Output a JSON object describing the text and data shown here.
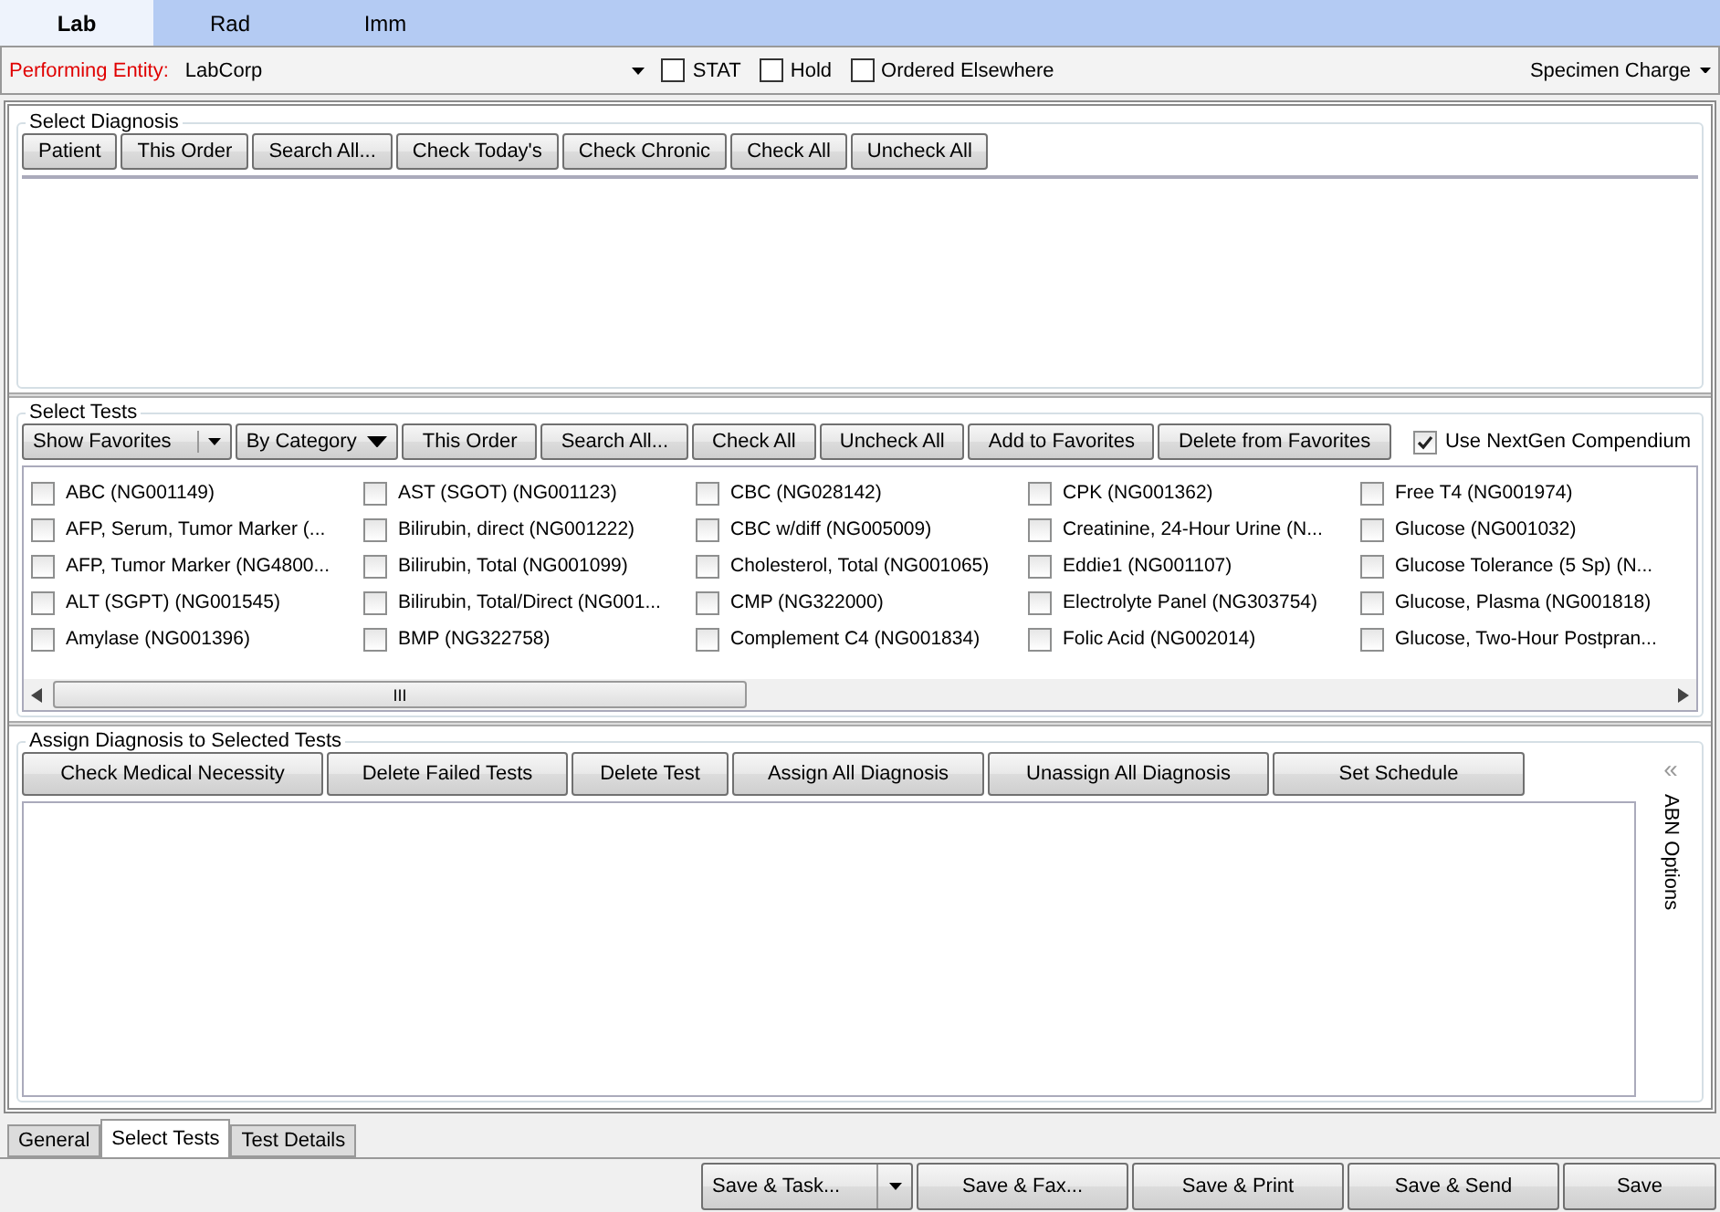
{
  "top_tabs": [
    {
      "label": "Lab",
      "selected": true
    },
    {
      "label": "Rad",
      "selected": false
    },
    {
      "label": "Imm",
      "selected": false
    }
  ],
  "entity_bar": {
    "label": "Performing Entity:",
    "value": "LabCorp",
    "options": [
      {
        "label": "STAT",
        "checked": false
      },
      {
        "label": "Hold",
        "checked": false
      },
      {
        "label": "Ordered Elsewhere",
        "checked": false
      }
    ],
    "menu": "Specimen Charge"
  },
  "diagnosis": {
    "title": "Select Diagnosis",
    "buttons": [
      "Patient",
      "This Order",
      "Search All...",
      "Check Today's",
      "Check Chronic",
      "Check All",
      "Uncheck All"
    ]
  },
  "tests": {
    "title": "Select Tests",
    "favorites": "Show Favorites",
    "category": "By Category",
    "buttons": [
      "This Order",
      "Search All...",
      "Check All",
      "Uncheck All",
      "Add to Favorites",
      "Delete from Favorites"
    ],
    "compendium": {
      "label": "Use NextGen Compendium",
      "checked": true
    },
    "columns": [
      [
        {
          "label": "ABC (NG001149)",
          "checked": false
        },
        {
          "label": "AFP, Serum, Tumor Marker (...",
          "checked": false
        },
        {
          "label": "AFP, Tumor Marker (NG4800...",
          "checked": false
        },
        {
          "label": "ALT (SGPT) (NG001545)",
          "checked": false
        },
        {
          "label": "Amylase (NG001396)",
          "checked": false
        }
      ],
      [
        {
          "label": "AST (SGOT) (NG001123)",
          "checked": false
        },
        {
          "label": "Bilirubin, direct (NG001222)",
          "checked": false
        },
        {
          "label": "Bilirubin, Total (NG001099)",
          "checked": false
        },
        {
          "label": "Bilirubin, Total/Direct (NG001...",
          "checked": false
        },
        {
          "label": "BMP (NG322758)",
          "checked": false
        }
      ],
      [
        {
          "label": "CBC (NG028142)",
          "checked": false
        },
        {
          "label": "CBC w/diff (NG005009)",
          "checked": false
        },
        {
          "label": "Cholesterol, Total (NG001065)",
          "checked": false
        },
        {
          "label": "CMP (NG322000)",
          "checked": false
        },
        {
          "label": "Complement C4 (NG001834)",
          "checked": false
        }
      ],
      [
        {
          "label": "CPK (NG001362)",
          "checked": false
        },
        {
          "label": "Creatinine, 24-Hour Urine (N...",
          "checked": false
        },
        {
          "label": "Eddie1 (NG001107)",
          "checked": false
        },
        {
          "label": "Electrolyte Panel (NG303754)",
          "checked": false
        },
        {
          "label": "Folic Acid (NG002014)",
          "checked": false
        }
      ],
      [
        {
          "label": "Free T4 (NG001974)",
          "checked": false
        },
        {
          "label": "Glucose (NG001032)",
          "checked": false
        },
        {
          "label": "Glucose Tolerance (5 Sp) (N...",
          "checked": false
        },
        {
          "label": "Glucose, Plasma (NG001818)",
          "checked": false
        },
        {
          "label": "Glucose, Two-Hour Postpran...",
          "checked": false
        }
      ]
    ],
    "scroll_glyph": "III"
  },
  "assign": {
    "title": "Assign Diagnosis to Selected Tests",
    "buttons": [
      "Check Medical Necessity",
      "Delete Failed Tests",
      "Delete Test",
      "Assign All Diagnosis",
      "Unassign All Diagnosis",
      "Set Schedule"
    ],
    "side_glyph": "«",
    "side_label": "ABN Options"
  },
  "bottom_tabs": [
    {
      "label": "General",
      "selected": false
    },
    {
      "label": "Select Tests",
      "selected": true
    },
    {
      "label": "Test Details",
      "selected": false
    }
  ],
  "footer": {
    "split_button": "Save & Task...",
    "buttons": [
      "Save & Fax...",
      "Save & Print",
      "Save & Send",
      "Save"
    ]
  }
}
